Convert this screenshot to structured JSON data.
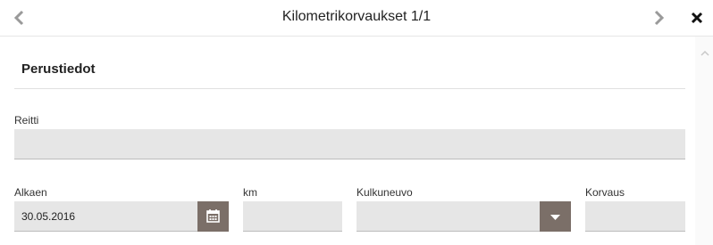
{
  "header": {
    "title": "Kilometrikorvaukset 1/1",
    "prev_icon": "chevron-left-icon",
    "next_icon": "chevron-right-icon",
    "close_icon": "close-icon"
  },
  "section": {
    "title": "Perustiedot"
  },
  "form": {
    "route": {
      "label": "Reitti",
      "value": ""
    },
    "start": {
      "label": "Alkaen",
      "value": "30.05.2016",
      "icon": "calendar-icon"
    },
    "km": {
      "label": "km",
      "value": ""
    },
    "vehicle": {
      "label": "Kulkuneuvo",
      "value": "",
      "icon": "caret-down-icon"
    },
    "compensation": {
      "label": "Korvaus",
      "value": ""
    }
  },
  "colors": {
    "field_bg": "#e6e6e6",
    "button_bg": "#7b6f68"
  }
}
